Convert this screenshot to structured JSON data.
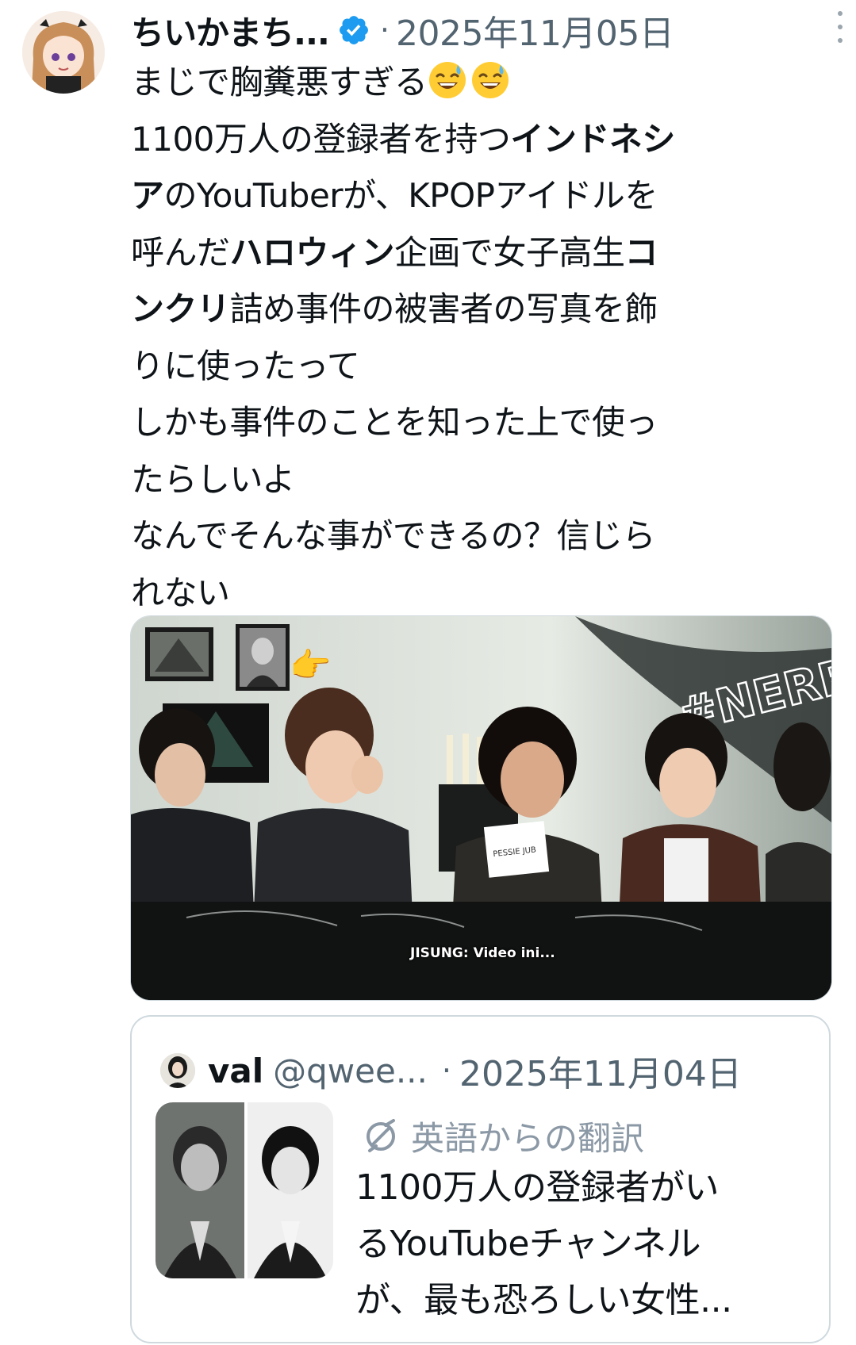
{
  "post": {
    "author_name": "ちいかまち...",
    "date": "2025年11月05日",
    "separator": "·",
    "lines": [
      [
        {
          "t": "まじで胸糞悪すぎる",
          "b": false
        }
      ],
      [
        {
          "t": "1100万人の登録者を持つ",
          "b": false
        },
        {
          "t": "インドネシ",
          "b": true
        }
      ],
      [
        {
          "t": "ア",
          "b": true
        },
        {
          "t": "のYouTuberが、KPOPアイドルを",
          "b": false
        }
      ],
      [
        {
          "t": "呼んだ",
          "b": false
        },
        {
          "t": "ハロウィン",
          "b": true
        },
        {
          "t": "企画で女子高生",
          "b": false
        },
        {
          "t": "コ",
          "b": true
        }
      ],
      [
        {
          "t": "ンクリ",
          "b": true
        },
        {
          "t": "詰め事件の被害者の写真を飾",
          "b": false
        }
      ],
      [
        {
          "t": "りに使ったって",
          "b": false
        }
      ],
      [
        {
          "t": "しかも事件のことを知った上で使っ",
          "b": false
        }
      ],
      [
        {
          "t": "たらしいよ",
          "b": false
        }
      ],
      [
        {
          "t": "なんでそんな事ができるの？信じら",
          "b": false
        }
      ],
      [
        {
          "t": "れない",
          "b": false
        }
      ]
    ],
    "emoji": [
      "grinning-sweat-emoji",
      "grinning-sweat-emoji"
    ]
  },
  "media": {
    "subtitle": "JISUNG: Video ini...",
    "paper_text": "PESSIE JUB",
    "neon_text": "#NERR"
  },
  "quote": {
    "name": "val",
    "handle": "@qwee...",
    "separator": "·",
    "date": "2025年11月04日",
    "translation_label": "英語からの翻訳",
    "lines": [
      "1100万人の登録者がい",
      "るYouTubeチャンネル",
      "が、最も恐ろしい女性..."
    ]
  },
  "colors": {
    "text": "#0f1419",
    "secondary": "#536471",
    "verified": "#1d9bf0",
    "border": "#cfd9de"
  },
  "icons": {
    "verified": "verified-badge-icon",
    "more": "more-vertical-icon",
    "translate": "translate-icon"
  }
}
